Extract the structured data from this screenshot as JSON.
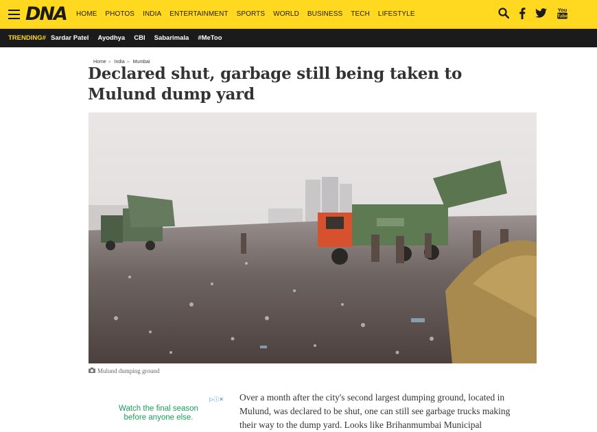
{
  "header": {
    "logo": "DNA",
    "nav": [
      "HOME",
      "PHOTOS",
      "INDIA",
      "ENTERTAINMENT",
      "SPORTS",
      "WORLD",
      "BUSINESS",
      "TECH",
      "LIFESTYLE"
    ],
    "icons": [
      "search-icon",
      "facebook-icon",
      "twitter-icon",
      "youtube-icon"
    ],
    "youtube_label": "You Tube"
  },
  "trending": {
    "label": "TRENDING#",
    "items": [
      "Sardar Patel",
      "Ayodhya",
      "CBI",
      "Sabarimala",
      "#MeToo"
    ]
  },
  "breadcrumb": [
    "Home",
    "India",
    "Mumbai"
  ],
  "article": {
    "title": "Declared shut, garbage still being taken to Mulund dump yard",
    "caption": "Mulund dumping ground",
    "body": "Over a month after the city's second largest dumping ground, located in Mulund, was declared to be shut, one can still see garbage trucks making their way to the dump yard. Looks like Brihanmumbai Municipal"
  },
  "ad": {
    "text": "Watch the final season before anyone else."
  },
  "colors": {
    "brand_yellow": "#ffd81f",
    "dark": "#1b1b1b",
    "ad_green": "#18a05a"
  }
}
